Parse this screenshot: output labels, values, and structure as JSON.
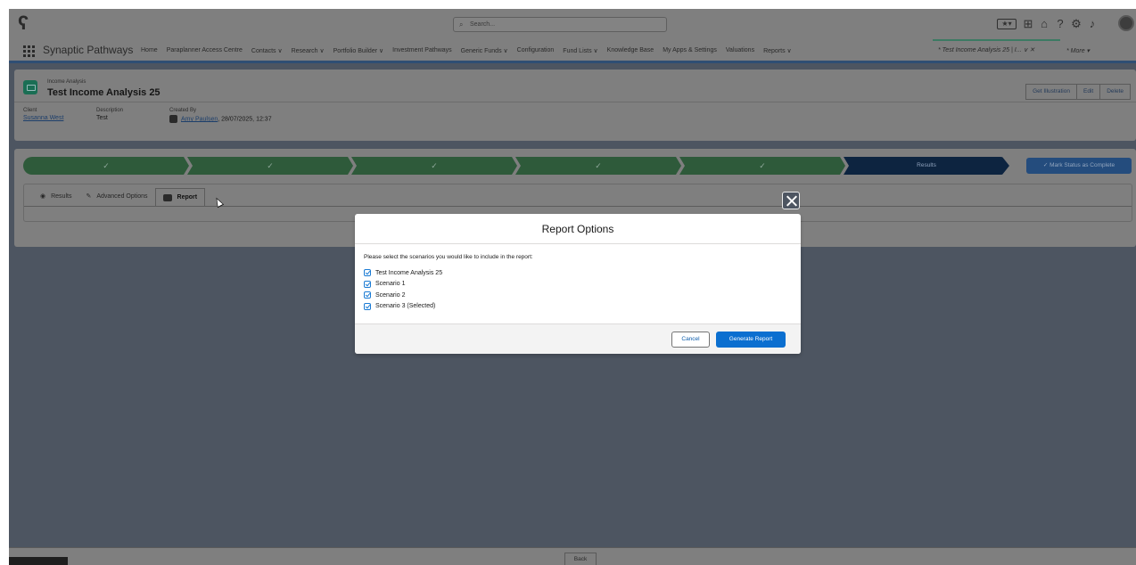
{
  "topbar": {
    "search_placeholder": "Search...",
    "favorites_icon": "star-icon",
    "colors": {
      "bar": "#7f7f7f",
      "overlay": "#4d5561",
      "brand_accent": "#2f4e74"
    }
  },
  "nav": {
    "app_name": "Synaptic Pathways",
    "items": [
      "Home",
      "Paraplanner Access Centre",
      "Contacts ∨",
      "Research ∨",
      "Portfolio Builder ∨",
      "Investment Pathways",
      "Generic Funds ∨",
      "Configuration",
      "Fund Lists ∨",
      "Knowledge Base",
      "My Apps & Settings",
      "Valuations",
      "Reports ∨"
    ],
    "active_tab": "* Test Income Analysis 25 | I...  ∨  ✕",
    "more": "* More  ▾"
  },
  "record": {
    "kind": "Income Analysis",
    "title": "Test Income Analysis 25",
    "buttons": [
      "Get Illustration",
      "Edit",
      "Delete"
    ],
    "fields": {
      "client_label": "Client",
      "client_value": "Susanna West",
      "description_label": "Description",
      "description_value": "Test",
      "created_by_label": "Created By",
      "created_by_user": "Amy Paulsen",
      "created_by_date": ", 28/07/2025, 12:37"
    }
  },
  "path": {
    "steps": [
      "✓",
      "✓",
      "✓",
      "✓",
      "✓",
      "Results"
    ],
    "mark_complete": "✓  Mark Status as Complete",
    "complete_color": "#2e5a3a",
    "current_color": "#0d2440"
  },
  "tabs": [
    {
      "label": "Results",
      "icon": "eye-icon"
    },
    {
      "label": "Advanced Options",
      "icon": "pencil-icon"
    },
    {
      "label": "Report",
      "icon": "report-icon"
    }
  ],
  "modal": {
    "title": "Report Options",
    "prompt": "Please select the scenarios you would like to include in the report:",
    "options": [
      {
        "label": "Test Income Analysis 25",
        "checked": true
      },
      {
        "label": "Scenario 1",
        "checked": true
      },
      {
        "label": "Scenario 2",
        "checked": true
      },
      {
        "label": "Scenario 3 (Selected)",
        "checked": true
      }
    ],
    "cancel_label": "Cancel",
    "generate_label": "Generate Report",
    "primary_color": "#0b6fd0"
  },
  "footer": {
    "back_label": "Back"
  }
}
